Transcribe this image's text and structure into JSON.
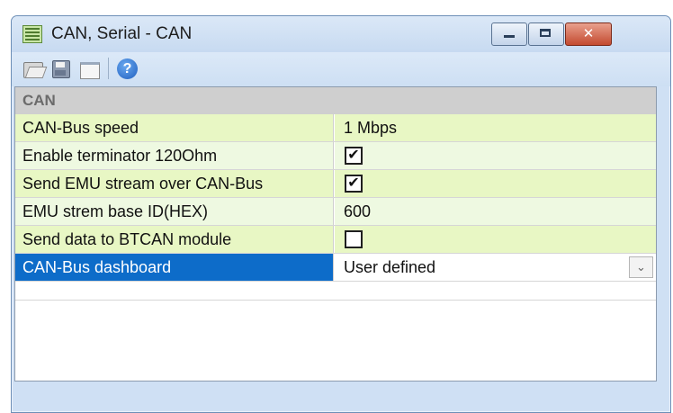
{
  "window": {
    "title": "CAN, Serial - CAN",
    "buttons": {
      "minimize": "minimize",
      "maximize": "maximize",
      "close": "✕"
    }
  },
  "toolbar": {
    "icons": [
      "open-folder-icon",
      "save-icon",
      "window-icon",
      "help-icon"
    ],
    "help_glyph": "?"
  },
  "grid": {
    "category": "CAN",
    "rows": [
      {
        "name": "CAN-Bus speed",
        "value": "1 Mbps",
        "type": "text"
      },
      {
        "name": "Enable terminator 120Ohm",
        "value": "✔",
        "type": "checkbox",
        "checked": true
      },
      {
        "name": "Send EMU stream over CAN-Bus",
        "value": "✔",
        "type": "checkbox",
        "checked": true
      },
      {
        "name": "EMU strem base ID(HEX)",
        "value": "600",
        "type": "text"
      },
      {
        "name": "Send data to BTCAN module",
        "value": "",
        "type": "checkbox",
        "checked": false
      },
      {
        "name": "CAN-Bus dashboard",
        "value": "User defined",
        "type": "dropdown",
        "selected": true
      }
    ],
    "dropdown_glyph": "⌄"
  },
  "colors": {
    "row_yellow": "#e8f7c4",
    "row_green": "#eef9e1",
    "selected": "#0d6cc9",
    "category_bg": "#cfcfcf"
  }
}
